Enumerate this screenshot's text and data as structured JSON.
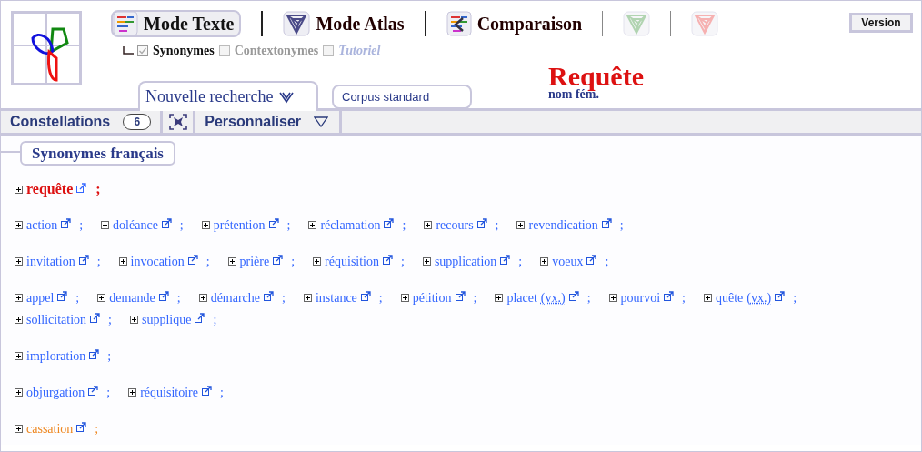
{
  "header": {
    "modes": [
      {
        "label": "Mode Texte",
        "selected": true,
        "kind": "wordcloud"
      },
      {
        "label": "Mode Atlas",
        "selected": false,
        "kind": "atlas"
      },
      {
        "label": "Comparaison",
        "selected": false,
        "kind": "compare"
      }
    ],
    "extra_tools": [
      {
        "kind": "green"
      },
      {
        "kind": "red"
      }
    ],
    "options": [
      {
        "label": "Synonymes",
        "checked": true,
        "disabled": false,
        "italic": false
      },
      {
        "label": "Contextonymes",
        "checked": false,
        "disabled": true,
        "italic": false
      },
      {
        "label": "Tutoriel",
        "checked": false,
        "disabled": true,
        "italic": true
      }
    ],
    "search_tab": "Nouvelle recherche",
    "corpus": "Corpus standard",
    "version_button": "Version",
    "query": {
      "word": "Requête",
      "category": "nom fém."
    }
  },
  "toolbar": {
    "constellations": "Constellations",
    "count": "6",
    "customize": "Personnaliser"
  },
  "section_title": "Synonymes français",
  "groups": [
    {
      "kind": "headword",
      "color": "#dd1111",
      "words": [
        {
          "text": "requête"
        }
      ]
    },
    {
      "kind": "synonyms",
      "color": "#3366ff",
      "words": [
        {
          "text": "action"
        },
        {
          "text": "doléance"
        },
        {
          "text": "prétention"
        },
        {
          "text": "réclamation"
        },
        {
          "text": "recours"
        },
        {
          "text": "revendication"
        }
      ]
    },
    {
      "kind": "synonyms",
      "color": "#3366ff",
      "words": [
        {
          "text": "invitation"
        },
        {
          "text": "invocation"
        },
        {
          "text": "prière"
        },
        {
          "text": "réquisition"
        },
        {
          "text": "supplication"
        },
        {
          "text": "voeux"
        }
      ]
    },
    {
      "kind": "synonyms",
      "color": "#3366ff",
      "words": [
        {
          "text": "appel"
        },
        {
          "text": "demande"
        },
        {
          "text": "démarche"
        },
        {
          "text": "instance"
        },
        {
          "text": "pétition"
        },
        {
          "text": "placet",
          "note": "(vx.)"
        },
        {
          "text": "pourvoi"
        },
        {
          "text": "quête",
          "note": "(vx.)"
        },
        {
          "text": "sollicitation"
        },
        {
          "text": "supplique"
        }
      ]
    },
    {
      "kind": "synonyms",
      "color": "#3366ff",
      "words": [
        {
          "text": "imploration"
        }
      ]
    },
    {
      "kind": "synonyms",
      "color": "#3366ff",
      "words": [
        {
          "text": "objurgation"
        },
        {
          "text": "réquisitoire"
        }
      ]
    },
    {
      "kind": "synonyms",
      "color": "#ee8822",
      "words": [
        {
          "text": "cassation"
        }
      ]
    }
  ],
  "separator": ";"
}
